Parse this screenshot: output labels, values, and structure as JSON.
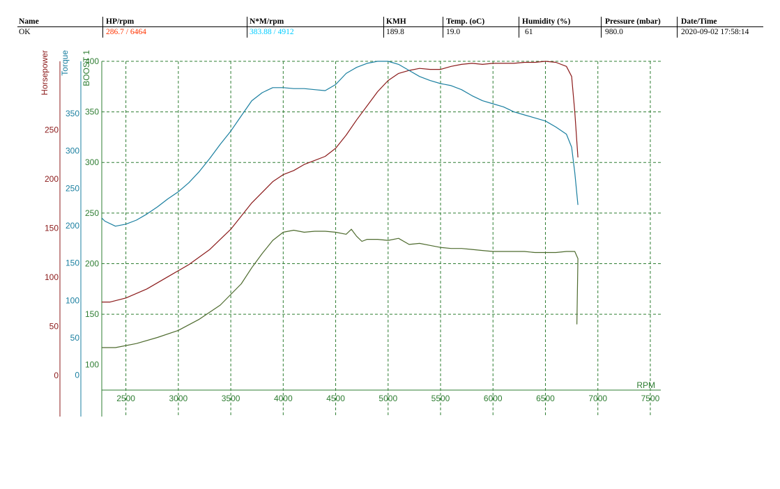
{
  "header": {
    "columns": [
      {
        "label": "Name",
        "value": "OK",
        "color": "#000000"
      },
      {
        "label": "HP/rpm",
        "value": "286.7 / 6464",
        "color": "#ff3300"
      },
      {
        "label": "N*M/rpm",
        "value": "383.88 / 4912",
        "color": "#00ccff"
      },
      {
        "label": "KMH",
        "value": "189.8",
        "color": "#000000"
      },
      {
        "label": "Temp. (oC)",
        "value": "19.0",
        "color": "#000000"
      },
      {
        "label": "Humidity (%)",
        "value": "61",
        "color": "#000000"
      },
      {
        "label": "Pressure (mbar)",
        "value": "980.0",
        "color": "#000000"
      },
      {
        "label": "Date/Time",
        "value": "2020-09-02 17:58:14",
        "color": "#000000"
      }
    ]
  },
  "chart_data": {
    "type": "line",
    "xlabel": "RPM",
    "x_ticks": [
      2500,
      3000,
      3500,
      4000,
      4500,
      5000,
      5500,
      6000,
      6500,
      7000,
      7500
    ],
    "xlim": [
      2270,
      7600
    ],
    "grid": true,
    "colors": {
      "grid": "#2e7d32",
      "axis": "#2e7d32",
      "hp": "#8b1a1a",
      "torque": "#1a7fa0",
      "boost": "#4e6b2e"
    },
    "axes": [
      {
        "name": "Horsepower",
        "color": "#8b1a1a",
        "ylim": [
          -15,
          320
        ],
        "ticks": [
          0,
          50,
          100,
          150,
          200,
          250
        ]
      },
      {
        "name": "Torque",
        "color": "#1a7fa0",
        "ylim": [
          -20,
          420
        ],
        "ticks": [
          0,
          50,
          100,
          150,
          200,
          250,
          300,
          350
        ]
      },
      {
        "name": "BOOST 1",
        "color": "#2e7d32",
        "ylim": [
          75,
          400
        ],
        "ticks": [
          100,
          150,
          200,
          250,
          300,
          350,
          400
        ]
      }
    ],
    "series": [
      {
        "key": "hp",
        "axis": 2,
        "x": [
          2270,
          2350,
          2500,
          2700,
          2900,
          3100,
          3300,
          3500,
          3700,
          3900,
          4000,
          4100,
          4200,
          4300,
          4400,
          4500,
          4600,
          4700,
          4800,
          4900,
          5000,
          5100,
          5200,
          5300,
          5400,
          5500,
          5600,
          5700,
          5800,
          5900,
          6000,
          6100,
          6200,
          6300,
          6400,
          6500,
          6600,
          6700,
          6750,
          6780,
          6810
        ],
        "y": [
          162,
          162,
          166,
          175,
          187,
          199,
          214,
          234,
          260,
          281,
          288,
          292,
          298,
          302,
          306,
          314,
          327,
          342,
          356,
          370,
          381,
          388,
          391,
          393,
          392,
          392,
          395,
          397,
          398,
          397,
          398,
          398,
          398,
          399,
          399,
          400,
          399,
          395,
          385,
          350,
          305
        ]
      },
      {
        "key": "torque",
        "axis": 2,
        "x": [
          2270,
          2300,
          2400,
          2500,
          2600,
          2700,
          2800,
          2900,
          3000,
          3100,
          3200,
          3300,
          3400,
          3500,
          3600,
          3700,
          3800,
          3900,
          4000,
          4100,
          4200,
          4300,
          4400,
          4500,
          4600,
          4700,
          4800,
          4900,
          5000,
          5100,
          5200,
          5300,
          5400,
          5500,
          5600,
          5700,
          5800,
          5900,
          6000,
          6100,
          6200,
          6300,
          6400,
          6500,
          6600,
          6700,
          6750,
          6780,
          6810
        ],
        "y": [
          245,
          242,
          237,
          239,
          243,
          249,
          256,
          264,
          271,
          280,
          291,
          304,
          318,
          331,
          346,
          361,
          369,
          374,
          374,
          373,
          373,
          372,
          371,
          377,
          388,
          394,
          398,
          400,
          400,
          397,
          391,
          385,
          381,
          378,
          376,
          372,
          366,
          361,
          358,
          355,
          350,
          347,
          344,
          341,
          335,
          328,
          315,
          290,
          258
        ]
      },
      {
        "key": "boost",
        "axis": 2,
        "x": [
          2270,
          2400,
          2600,
          2800,
          3000,
          3200,
          3400,
          3600,
          3700,
          3800,
          3900,
          4000,
          4100,
          4200,
          4300,
          4400,
          4500,
          4600,
          4650,
          4700,
          4750,
          4800,
          4900,
          5000,
          5100,
          5200,
          5300,
          5400,
          5500,
          5600,
          5700,
          5800,
          5900,
          6000,
          6100,
          6200,
          6300,
          6400,
          6500,
          6600,
          6700,
          6780,
          6810,
          6800
        ],
        "y": [
          117,
          117,
          121,
          127,
          134,
          145,
          159,
          180,
          196,
          210,
          223,
          231,
          233,
          231,
          232,
          232,
          231,
          229,
          234,
          227,
          222,
          224,
          224,
          223,
          225,
          219,
          220,
          218,
          216,
          215,
          215,
          214,
          213,
          212,
          212,
          212,
          212,
          211,
          211,
          211,
          212,
          212,
          205,
          140
        ]
      }
    ]
  }
}
